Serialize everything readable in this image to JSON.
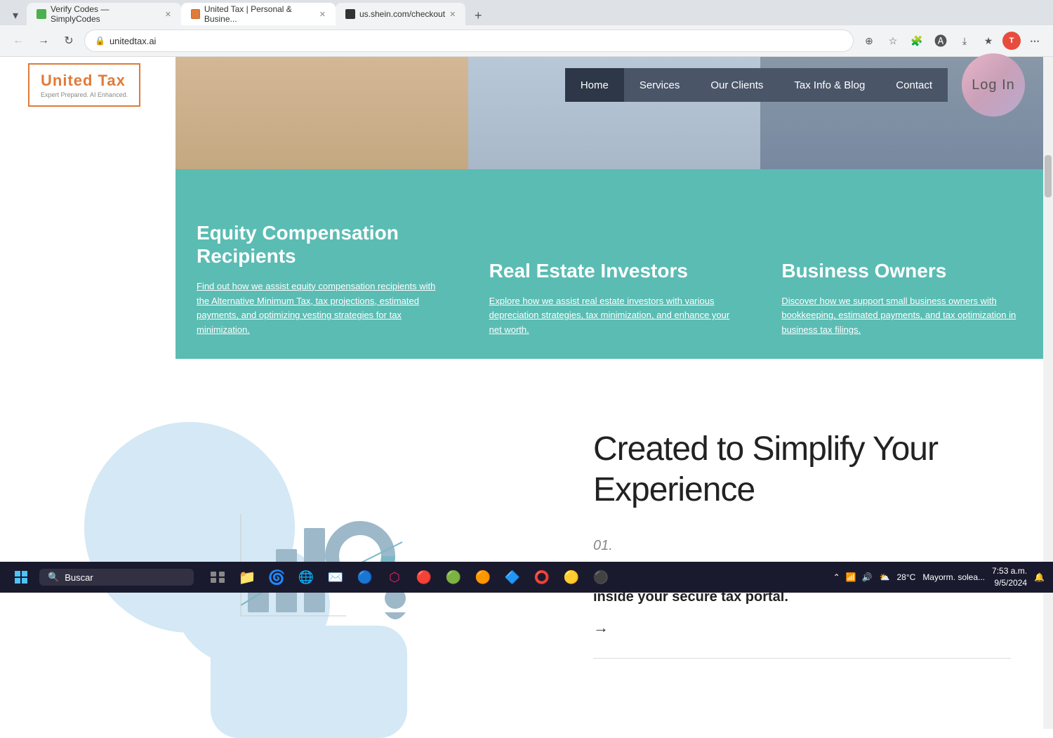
{
  "browser": {
    "tabs": [
      {
        "id": "tab1",
        "title": "Verify Codes — SimplyCodes",
        "favicon_color": "#4CAF50",
        "active": false
      },
      {
        "id": "tab2",
        "title": "United Tax | Personal & Busine...",
        "favicon_color": "#e07b39",
        "active": true
      },
      {
        "id": "tab3",
        "title": "us.shein.com/checkout",
        "favicon_color": "#000",
        "active": false
      }
    ],
    "url": "unitedtax.ai",
    "add_tab_label": "+"
  },
  "navbar": {
    "logo_text": "United Tax",
    "logo_sub": "Expert Prepared. AI Enhanced.",
    "menu_items": [
      {
        "id": "home",
        "label": "Home",
        "active": true
      },
      {
        "id": "services",
        "label": "Services",
        "active": false
      },
      {
        "id": "our_clients",
        "label": "Our Clients",
        "active": false
      },
      {
        "id": "tax_info_blog",
        "label": "Tax Info & Blog",
        "active": false
      },
      {
        "id": "contact",
        "label": "Contact",
        "active": false
      }
    ],
    "login_label": "Log In"
  },
  "cards": [
    {
      "id": "equity",
      "title": "Equity Compensation Recipients",
      "link_text": "Find out how we assist equity compensation recipients with the Alternative Minimum Tax, tax projections, estimated payments, and optimizing vesting strategies for tax minimization."
    },
    {
      "id": "real_estate",
      "title": "Real Estate Investors",
      "link_text": "Explore how we assist real estate investors with various depreciation strategies, tax minimization, and enhance your net worth."
    },
    {
      "id": "business",
      "title": "Business Owners",
      "link_text": "Discover how we support small business owners with bookkeeping, estimated payments, and tax optimization in business tax filings."
    }
  ],
  "simplify_section": {
    "title": "Created to Simplify Your Experience",
    "step_number": "01.",
    "step_text": "Upload your tax documents and answer a few questions inside your secure tax portal.",
    "arrow": "→"
  },
  "taskbar": {
    "search_placeholder": "Buscar",
    "time": "7:53 a.m.",
    "date": "9/5/2024",
    "weather": "28°C",
    "weather_desc": "Mayorm. solea..."
  }
}
